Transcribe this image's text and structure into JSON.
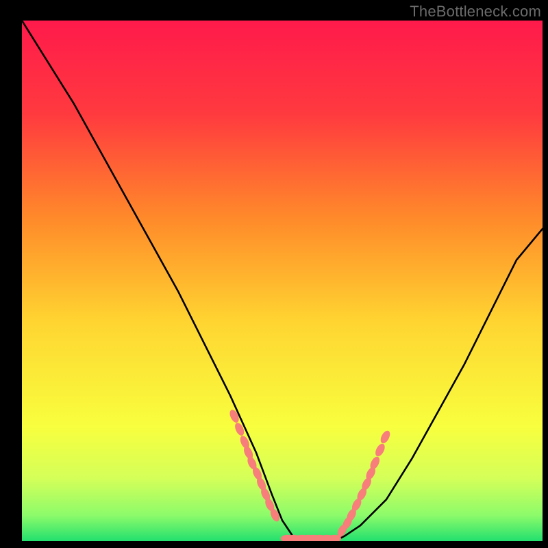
{
  "watermark": "TheBottleneck.com",
  "colors": {
    "bg": "#000000",
    "gradient_top": "#ff1a4b",
    "gradient_mid1": "#ff7a2a",
    "gradient_mid2": "#ffd531",
    "gradient_mid3": "#f6ff3a",
    "gradient_low": "#d7ff57",
    "gradient_bottom": "#22e06e",
    "curve": "#000000",
    "marker": "#f77e7a"
  },
  "chart_data": {
    "type": "line",
    "title": "",
    "xlabel": "",
    "ylabel": "",
    "xlim": [
      0,
      100
    ],
    "ylim": [
      0,
      100
    ],
    "grid": false,
    "legend": false,
    "series": [
      {
        "name": "bottleneck-curve",
        "x": [
          0,
          5,
          10,
          15,
          20,
          25,
          30,
          35,
          40,
          45,
          48,
          50,
          52,
          55,
          58,
          60,
          62,
          65,
          70,
          75,
          80,
          85,
          90,
          95,
          100
        ],
        "y": [
          100,
          92,
          84,
          75,
          66,
          57,
          48,
          38,
          28,
          17,
          9,
          4,
          1,
          0,
          0,
          0,
          1,
          3,
          8,
          16,
          25,
          34,
          44,
          54,
          60
        ]
      }
    ],
    "markers": [
      {
        "name": "left-cluster",
        "points": [
          {
            "x": 40.8,
            "y": 24.0
          },
          {
            "x": 41.8,
            "y": 21.5
          },
          {
            "x": 42.8,
            "y": 19.0
          },
          {
            "x": 43.5,
            "y": 17.0
          },
          {
            "x": 44.2,
            "y": 15.0
          },
          {
            "x": 45.2,
            "y": 13.0
          },
          {
            "x": 46.0,
            "y": 11.0
          },
          {
            "x": 46.8,
            "y": 9.0
          },
          {
            "x": 47.6,
            "y": 7.0
          },
          {
            "x": 48.6,
            "y": 5.0
          }
        ]
      },
      {
        "name": "bottom-cluster",
        "points": [
          {
            "x": 51.0,
            "y": 0.5
          },
          {
            "x": 52.2,
            "y": 0.5
          },
          {
            "x": 53.8,
            "y": 0.5
          },
          {
            "x": 55.0,
            "y": 0.5
          },
          {
            "x": 56.0,
            "y": 0.5
          },
          {
            "x": 57.2,
            "y": 0.5
          },
          {
            "x": 58.6,
            "y": 0.5
          },
          {
            "x": 60.0,
            "y": 0.5
          }
        ]
      },
      {
        "name": "right-cluster",
        "points": [
          {
            "x": 61.5,
            "y": 2.0
          },
          {
            "x": 62.5,
            "y": 3.5
          },
          {
            "x": 63.3,
            "y": 5.0
          },
          {
            "x": 64.3,
            "y": 7.0
          },
          {
            "x": 65.3,
            "y": 9.0
          },
          {
            "x": 66.2,
            "y": 11.0
          },
          {
            "x": 67.0,
            "y": 13.0
          },
          {
            "x": 67.8,
            "y": 15.0
          },
          {
            "x": 68.8,
            "y": 17.5
          },
          {
            "x": 69.8,
            "y": 20.0
          }
        ]
      }
    ]
  }
}
